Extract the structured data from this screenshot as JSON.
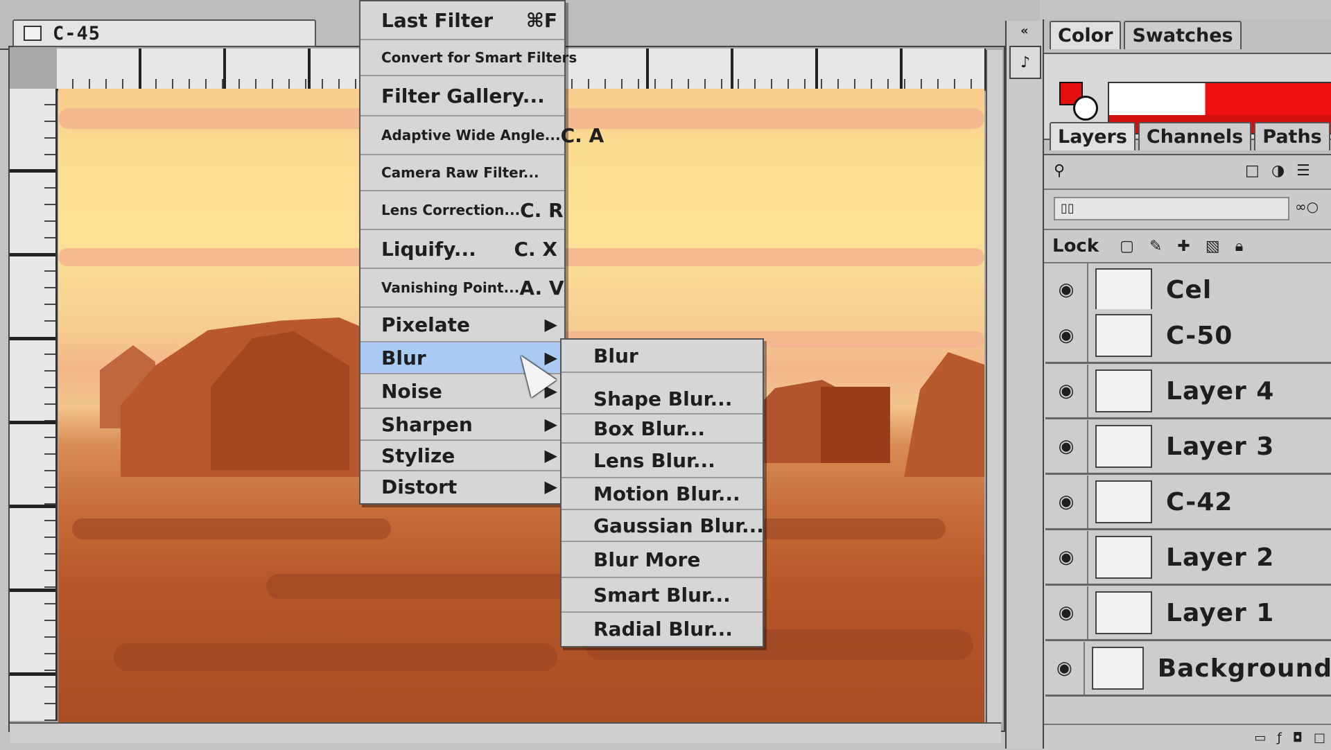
{
  "document": {
    "title": "C-45"
  },
  "filter_menu": {
    "items": [
      {
        "label": "Last Filter",
        "underline": "F",
        "shortcut": "⌘F"
      },
      {
        "label": "Convert for Smart Filters",
        "shortcut": ""
      },
      {
        "label": "Filter Gallery...",
        "shortcut": ""
      },
      {
        "label": "Adaptive Wide Angle...",
        "shortcut": "C. A"
      },
      {
        "label": "Camera Raw Filter...",
        "shortcut": ""
      },
      {
        "label": "Lens Correction...",
        "shortcut": "C. R"
      },
      {
        "label": "Liquify...",
        "shortcut": "C. X"
      },
      {
        "label": "Vanishing Point...",
        "shortcut": "A. V"
      },
      {
        "label": "Pixelate",
        "submenu": true
      },
      {
        "label": "Blur",
        "submenu": true,
        "highlighted": true
      },
      {
        "label": "Noise",
        "submenu": true
      },
      {
        "label": "Sharpen",
        "submenu": true
      },
      {
        "label": "Stylize",
        "submenu": true
      },
      {
        "label": "Distort",
        "submenu": true
      }
    ]
  },
  "blur_submenu": {
    "items": [
      "Blur",
      "Shape Blur...",
      "Box Blur...",
      "Lens Blur...",
      "Motion Blur...",
      "Gaussian Blur...",
      "Blur More",
      "Smart Blur...",
      "Radial Blur..."
    ]
  },
  "color_panel": {
    "tabs": [
      "Color",
      "Swatches"
    ],
    "foreground": "#e41010",
    "background": "#ffffff"
  },
  "layers_panel": {
    "tabs": [
      "Layers",
      "Channels",
      "Paths"
    ],
    "lock_label": "Lock",
    "layers": [
      "Cel",
      "C-50",
      "Layer 4",
      "Layer 3",
      "C-42",
      "Layer 2",
      "Layer 1",
      "Background"
    ]
  },
  "colors": {
    "highlight": "#a9cbf4",
    "menu_bg": "#d6d6d6"
  }
}
